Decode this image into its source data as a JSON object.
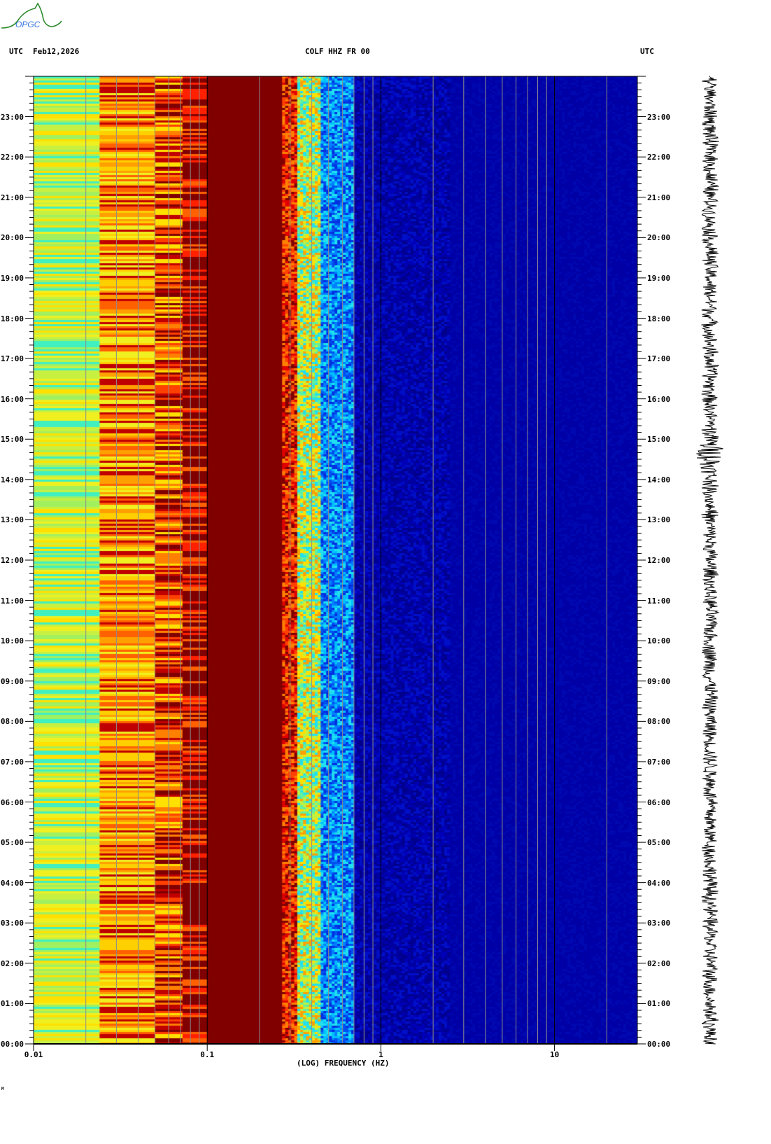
{
  "header": {
    "left_tz": "UTC",
    "date": "Feb12,2026",
    "station": "COLF HHZ FR 00",
    "right_tz": "UTC"
  },
  "logo": {
    "text": "OPGC"
  },
  "footer_mark": "M",
  "chart_data": {
    "type": "heatmap",
    "title": "COLF HHZ FR 00",
    "xlabel": "(LOG) FREQUENCY (HZ)",
    "ylabel": "UTC",
    "x_scale": "log",
    "xlim": [
      0.01,
      30
    ],
    "ylim_hours": [
      0,
      24
    ],
    "x_ticks": [
      {
        "value": 0.01,
        "label": "0.01"
      },
      {
        "value": 0.1,
        "label": "0.1"
      },
      {
        "value": 1,
        "label": "1"
      },
      {
        "value": 10,
        "label": "10"
      }
    ],
    "y_ticks": [
      "00:00",
      "01:00",
      "02:00",
      "03:00",
      "04:00",
      "05:00",
      "06:00",
      "07:00",
      "08:00",
      "09:00",
      "10:00",
      "11:00",
      "12:00",
      "13:00",
      "14:00",
      "15:00",
      "16:00",
      "17:00",
      "18:00",
      "19:00",
      "20:00",
      "21:00",
      "22:00",
      "23:00"
    ],
    "bands": [
      {
        "fmin": 0.01,
        "fmax": 0.024,
        "palette": [
          "#f0f020",
          "#c8f040",
          "#a0f060",
          "#40f0c0",
          "#ffe000"
        ]
      },
      {
        "fmin": 0.024,
        "fmax": 0.05,
        "palette": [
          "#ffd000",
          "#ffa000",
          "#ff6000",
          "#c00000",
          "#f0f020"
        ]
      },
      {
        "fmin": 0.05,
        "fmax": 0.072,
        "palette": [
          "#ff8000",
          "#ff4000",
          "#ffe000",
          "#c00000",
          "#800000"
        ]
      },
      {
        "fmin": 0.072,
        "fmax": 0.1,
        "palette": [
          "#800000",
          "#800000",
          "#800000",
          "#ff2000",
          "#ff6000"
        ]
      },
      {
        "fmin": 0.1,
        "fmax": 0.27,
        "palette": [
          "#800000"
        ]
      },
      {
        "fmin": 0.27,
        "fmax": 0.33,
        "palette": [
          "#800000",
          "#e00000",
          "#ff4000",
          "#ff8000"
        ]
      },
      {
        "fmin": 0.33,
        "fmax": 0.45,
        "palette": [
          "#ffa000",
          "#ffe000",
          "#c0f040",
          "#60f0a0",
          "#20e0f0"
        ]
      },
      {
        "fmin": 0.45,
        "fmax": 0.7,
        "palette": [
          "#00c0ff",
          "#0080ff",
          "#0050f0",
          "#0030e0",
          "#20e0f0"
        ]
      },
      {
        "fmin": 0.7,
        "fmax": 2.5,
        "palette": [
          "#0000b8",
          "#0000a0",
          "#00008c",
          "#0010c8"
        ]
      },
      {
        "fmin": 2.5,
        "fmax": 30,
        "palette": [
          "#0000a8",
          "#0000a4",
          "#0008b0"
        ]
      }
    ],
    "event_hour": 14.6,
    "colors": {
      "grid_minor": "#8c8c8c",
      "grid_decade": "#000000",
      "trace": "#000000"
    }
  }
}
